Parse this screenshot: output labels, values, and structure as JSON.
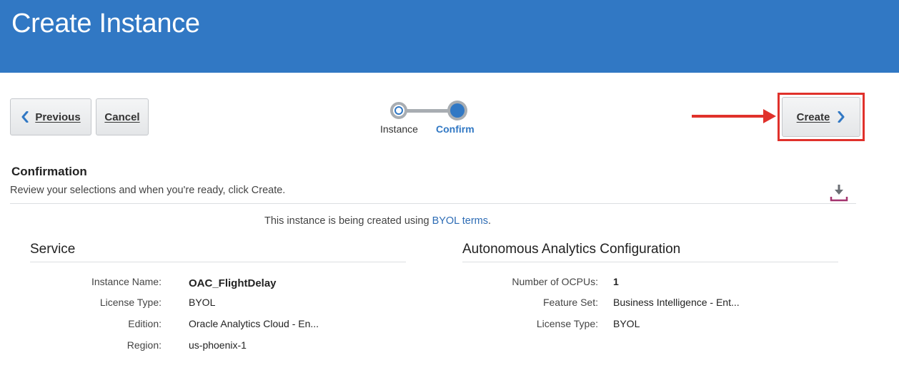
{
  "header": {
    "title": "Create Instance"
  },
  "toolbar": {
    "previous_label": "Previous",
    "cancel_label": "Cancel",
    "create_label": "Create"
  },
  "train": {
    "steps": [
      {
        "label": "Instance",
        "state": "visited"
      },
      {
        "label": "Confirm",
        "state": "current"
      }
    ]
  },
  "confirmation": {
    "title": "Confirmation",
    "description": "Review your selections and when you're ready, click Create.",
    "byol_prefix": "This instance is being created using ",
    "byol_link": "BYOL terms",
    "byol_suffix": "."
  },
  "service": {
    "title": "Service",
    "rows": [
      {
        "label": "Instance Name:",
        "value": "OAC_FlightDelay"
      },
      {
        "label": "License Type:",
        "value": "BYOL"
      },
      {
        "label": "Edition:",
        "value": "Oracle Analytics Cloud - En..."
      },
      {
        "label": "Region:",
        "value": "us-phoenix-1"
      }
    ]
  },
  "config": {
    "title": "Autonomous Analytics Configuration",
    "rows": [
      {
        "label": "Number of OCPUs:",
        "value": "1"
      },
      {
        "label": "Feature Set:",
        "value": "Business Intelligence - Ent..."
      },
      {
        "label": "License Type:",
        "value": "BYOL"
      }
    ]
  },
  "icons": {
    "previous": "chevron-left-icon",
    "create": "chevron-right-icon",
    "download": "download-icon"
  },
  "colors": {
    "header": "#3178c4",
    "accent": "#3178c4",
    "annotation": "#e0312b"
  }
}
